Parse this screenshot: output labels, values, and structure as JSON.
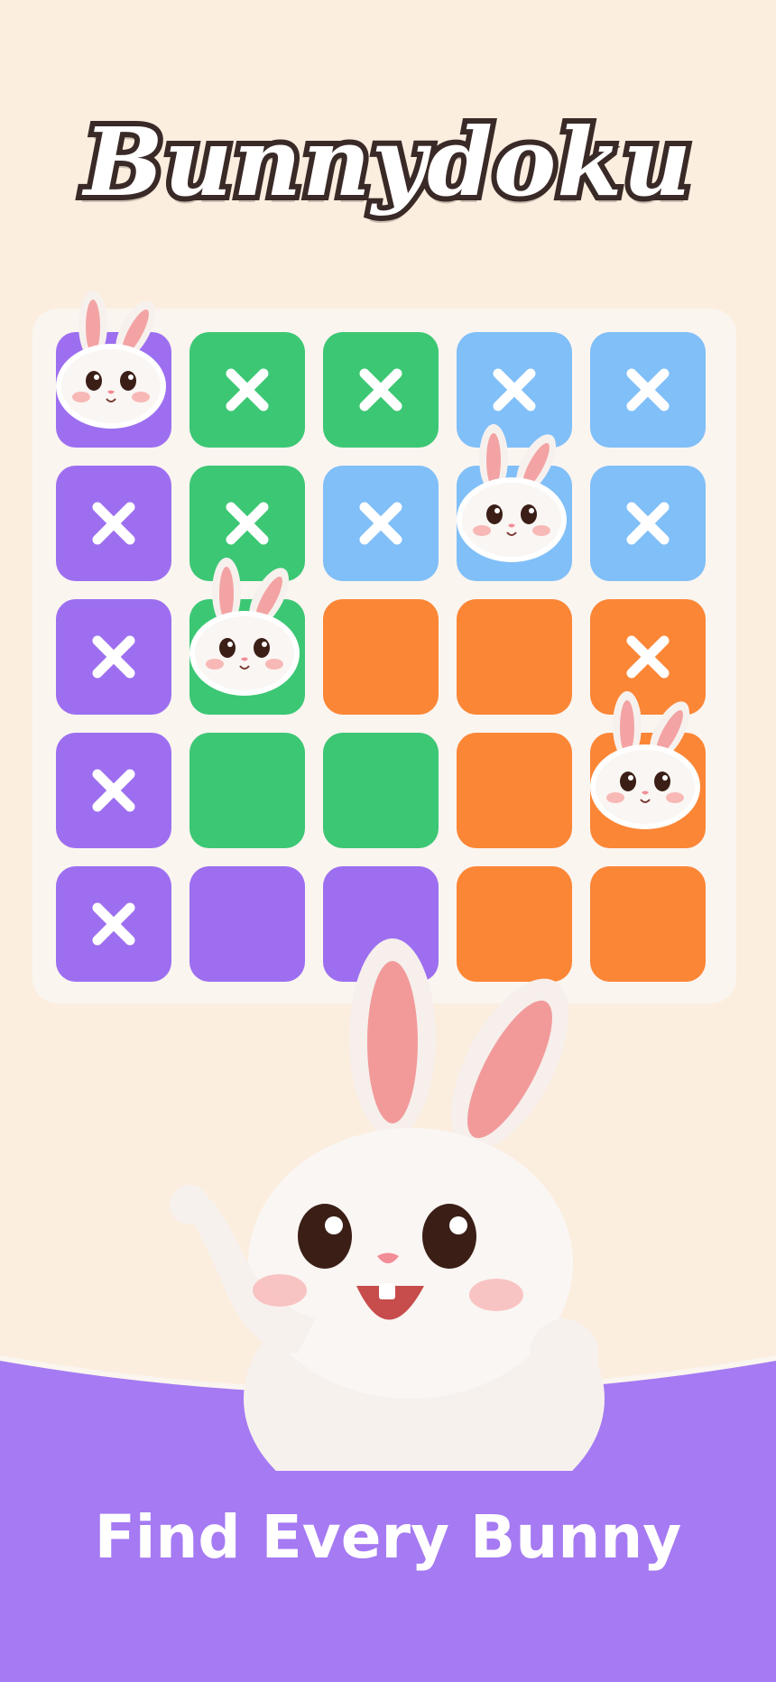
{
  "app": {
    "title": "Bunnydoku",
    "tagline": "Find Every Bunny"
  },
  "colors": {
    "purple": "#9d6ff0",
    "green": "#3cc774",
    "blue": "#80bff8",
    "orange": "#fb8636",
    "background": "#fbeedf",
    "band": "#a57af2"
  },
  "board": {
    "rows": [
      [
        {
          "color": "purple",
          "state": "bunny"
        },
        {
          "color": "green",
          "state": "x"
        },
        {
          "color": "green",
          "state": "x"
        },
        {
          "color": "blue",
          "state": "x"
        },
        {
          "color": "blue",
          "state": "x"
        }
      ],
      [
        {
          "color": "purple",
          "state": "x"
        },
        {
          "color": "green",
          "state": "x"
        },
        {
          "color": "blue",
          "state": "x"
        },
        {
          "color": "blue",
          "state": "bunny"
        },
        {
          "color": "blue",
          "state": "x"
        }
      ],
      [
        {
          "color": "purple",
          "state": "x"
        },
        {
          "color": "green",
          "state": "bunny"
        },
        {
          "color": "orange",
          "state": "empty"
        },
        {
          "color": "orange",
          "state": "empty"
        },
        {
          "color": "orange",
          "state": "x"
        }
      ],
      [
        {
          "color": "purple",
          "state": "x"
        },
        {
          "color": "green",
          "state": "empty"
        },
        {
          "color": "green",
          "state": "empty"
        },
        {
          "color": "orange",
          "state": "empty"
        },
        {
          "color": "orange",
          "state": "bunny"
        }
      ],
      [
        {
          "color": "purple",
          "state": "x"
        },
        {
          "color": "purple",
          "state": "empty"
        },
        {
          "color": "purple",
          "state": "empty"
        },
        {
          "color": "orange",
          "state": "empty"
        },
        {
          "color": "orange",
          "state": "empty"
        }
      ]
    ]
  }
}
